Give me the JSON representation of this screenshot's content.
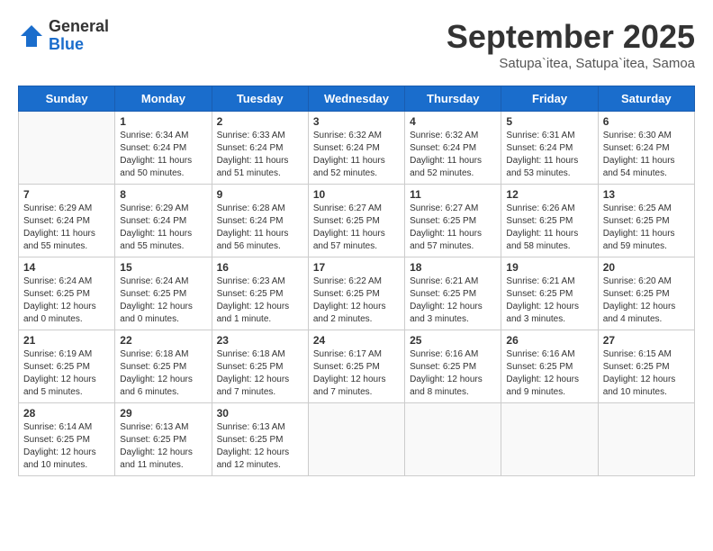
{
  "logo": {
    "general": "General",
    "blue": "Blue"
  },
  "title": "September 2025",
  "subtitle": "Satupa`itea, Satupa`itea, Samoa",
  "days_of_week": [
    "Sunday",
    "Monday",
    "Tuesday",
    "Wednesday",
    "Thursday",
    "Friday",
    "Saturday"
  ],
  "weeks": [
    [
      {
        "day": "",
        "info": ""
      },
      {
        "day": "1",
        "info": "Sunrise: 6:34 AM\nSunset: 6:24 PM\nDaylight: 11 hours\nand 50 minutes."
      },
      {
        "day": "2",
        "info": "Sunrise: 6:33 AM\nSunset: 6:24 PM\nDaylight: 11 hours\nand 51 minutes."
      },
      {
        "day": "3",
        "info": "Sunrise: 6:32 AM\nSunset: 6:24 PM\nDaylight: 11 hours\nand 52 minutes."
      },
      {
        "day": "4",
        "info": "Sunrise: 6:32 AM\nSunset: 6:24 PM\nDaylight: 11 hours\nand 52 minutes."
      },
      {
        "day": "5",
        "info": "Sunrise: 6:31 AM\nSunset: 6:24 PM\nDaylight: 11 hours\nand 53 minutes."
      },
      {
        "day": "6",
        "info": "Sunrise: 6:30 AM\nSunset: 6:24 PM\nDaylight: 11 hours\nand 54 minutes."
      }
    ],
    [
      {
        "day": "7",
        "info": "Sunrise: 6:29 AM\nSunset: 6:24 PM\nDaylight: 11 hours\nand 55 minutes."
      },
      {
        "day": "8",
        "info": "Sunrise: 6:29 AM\nSunset: 6:24 PM\nDaylight: 11 hours\nand 55 minutes."
      },
      {
        "day": "9",
        "info": "Sunrise: 6:28 AM\nSunset: 6:24 PM\nDaylight: 11 hours\nand 56 minutes."
      },
      {
        "day": "10",
        "info": "Sunrise: 6:27 AM\nSunset: 6:25 PM\nDaylight: 11 hours\nand 57 minutes."
      },
      {
        "day": "11",
        "info": "Sunrise: 6:27 AM\nSunset: 6:25 PM\nDaylight: 11 hours\nand 57 minutes."
      },
      {
        "day": "12",
        "info": "Sunrise: 6:26 AM\nSunset: 6:25 PM\nDaylight: 11 hours\nand 58 minutes."
      },
      {
        "day": "13",
        "info": "Sunrise: 6:25 AM\nSunset: 6:25 PM\nDaylight: 11 hours\nand 59 minutes."
      }
    ],
    [
      {
        "day": "14",
        "info": "Sunrise: 6:24 AM\nSunset: 6:25 PM\nDaylight: 12 hours\nand 0 minutes."
      },
      {
        "day": "15",
        "info": "Sunrise: 6:24 AM\nSunset: 6:25 PM\nDaylight: 12 hours\nand 0 minutes."
      },
      {
        "day": "16",
        "info": "Sunrise: 6:23 AM\nSunset: 6:25 PM\nDaylight: 12 hours\nand 1 minute."
      },
      {
        "day": "17",
        "info": "Sunrise: 6:22 AM\nSunset: 6:25 PM\nDaylight: 12 hours\nand 2 minutes."
      },
      {
        "day": "18",
        "info": "Sunrise: 6:21 AM\nSunset: 6:25 PM\nDaylight: 12 hours\nand 3 minutes."
      },
      {
        "day": "19",
        "info": "Sunrise: 6:21 AM\nSunset: 6:25 PM\nDaylight: 12 hours\nand 3 minutes."
      },
      {
        "day": "20",
        "info": "Sunrise: 6:20 AM\nSunset: 6:25 PM\nDaylight: 12 hours\nand 4 minutes."
      }
    ],
    [
      {
        "day": "21",
        "info": "Sunrise: 6:19 AM\nSunset: 6:25 PM\nDaylight: 12 hours\nand 5 minutes."
      },
      {
        "day": "22",
        "info": "Sunrise: 6:18 AM\nSunset: 6:25 PM\nDaylight: 12 hours\nand 6 minutes."
      },
      {
        "day": "23",
        "info": "Sunrise: 6:18 AM\nSunset: 6:25 PM\nDaylight: 12 hours\nand 7 minutes."
      },
      {
        "day": "24",
        "info": "Sunrise: 6:17 AM\nSunset: 6:25 PM\nDaylight: 12 hours\nand 7 minutes."
      },
      {
        "day": "25",
        "info": "Sunrise: 6:16 AM\nSunset: 6:25 PM\nDaylight: 12 hours\nand 8 minutes."
      },
      {
        "day": "26",
        "info": "Sunrise: 6:16 AM\nSunset: 6:25 PM\nDaylight: 12 hours\nand 9 minutes."
      },
      {
        "day": "27",
        "info": "Sunrise: 6:15 AM\nSunset: 6:25 PM\nDaylight: 12 hours\nand 10 minutes."
      }
    ],
    [
      {
        "day": "28",
        "info": "Sunrise: 6:14 AM\nSunset: 6:25 PM\nDaylight: 12 hours\nand 10 minutes."
      },
      {
        "day": "29",
        "info": "Sunrise: 6:13 AM\nSunset: 6:25 PM\nDaylight: 12 hours\nand 11 minutes."
      },
      {
        "day": "30",
        "info": "Sunrise: 6:13 AM\nSunset: 6:25 PM\nDaylight: 12 hours\nand 12 minutes."
      },
      {
        "day": "",
        "info": ""
      },
      {
        "day": "",
        "info": ""
      },
      {
        "day": "",
        "info": ""
      },
      {
        "day": "",
        "info": ""
      }
    ]
  ]
}
